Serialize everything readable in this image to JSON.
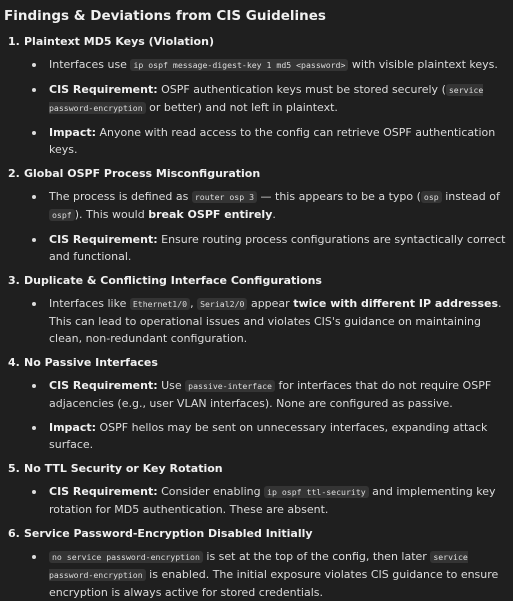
{
  "title": "Findings & Deviations from CIS Guidelines",
  "sections": [
    {
      "num": "1.",
      "title": "Plaintext MD5 Keys (Violation)",
      "b1": {
        "t1": "Interfaces use ",
        "c1": "ip ospf message-digest-key 1 md5 <password>",
        "t2": " with visible plaintext keys."
      },
      "b2": {
        "lbl": "CIS Requirement:",
        "t1": " OSPF authentication keys must be stored securely (",
        "c1": "service password-encryption",
        "t2": " or better) and not left in plaintext."
      },
      "b3": {
        "lbl": "Impact:",
        "t1": " Anyone with read access to the config can retrieve OSPF authentication keys."
      }
    },
    {
      "num": "2.",
      "title": "Global OSPF Process Misconfiguration",
      "b1": {
        "t1": "The process is defined as ",
        "c1": "router osp 3",
        "t2": " — this appears to be a typo (",
        "c2": "osp",
        "t3": " instead of ",
        "c3": "ospf",
        "t4": "). This would ",
        "bold": "break OSPF entirely",
        "t5": "."
      },
      "b2": {
        "lbl": "CIS Requirement:",
        "t1": " Ensure routing process configurations are syntactically correct and functional."
      }
    },
    {
      "num": "3.",
      "title": "Duplicate & Conflicting Interface Configurations",
      "b1": {
        "t1": "Interfaces like ",
        "c1": "Ethernet1/0",
        "t2": ", ",
        "c2": "Serial2/0",
        "t3": " appear ",
        "bold": "twice with different IP addresses",
        "t4": ". This can lead to operational issues and violates CIS's guidance on maintaining clean, non-redundant configuration."
      }
    },
    {
      "num": "4.",
      "title": "No Passive Interfaces",
      "b1": {
        "lbl": "CIS Requirement:",
        "t1": " Use ",
        "c1": "passive-interface",
        "t2": " for interfaces that do not require OSPF adjacencies (e.g., user VLAN interfaces). None are configured as passive."
      },
      "b2": {
        "lbl": "Impact:",
        "t1": " OSPF hellos may be sent on unnecessary interfaces, expanding attack surface."
      }
    },
    {
      "num": "5.",
      "title": "No TTL Security or Key Rotation",
      "b1": {
        "lbl": "CIS Requirement:",
        "t1": " Consider enabling ",
        "c1": "ip ospf ttl-security",
        "t2": " and implementing key rotation for MD5 authentication. These are absent."
      }
    },
    {
      "num": "6.",
      "title": "Service Password-Encryption Disabled Initially",
      "b1": {
        "c1": "no service password-encryption",
        "t1": " is set at the top of the config, then later ",
        "c2": "service password-encryption",
        "t2": " is enabled. The initial exposure violates CIS guidance to ensure encryption is always active for stored credentials."
      }
    }
  ]
}
